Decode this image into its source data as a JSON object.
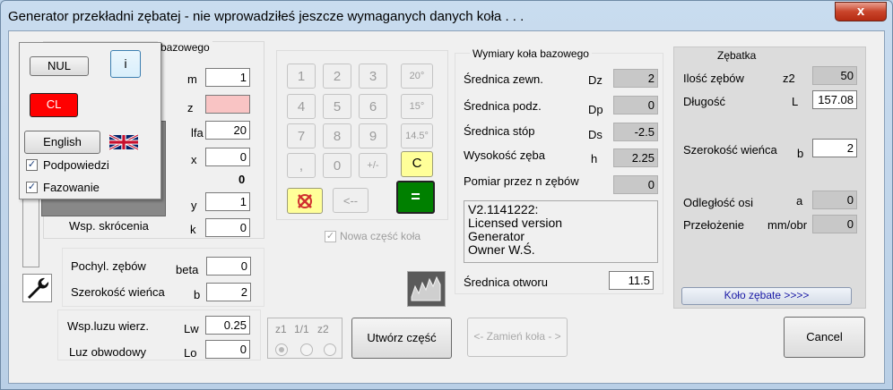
{
  "window": {
    "title": "Generator przekładni zębatej  -  nie wprowadziłeś jeszcze wymaganych danych koła . . .",
    "close_glyph": "x"
  },
  "popup": {
    "nul_label": "NUL",
    "info_label": "i",
    "cl_label": "CL",
    "english_label": "English",
    "podpowiedzi_label": "Podpowiedzi",
    "fazowanie_label": "Fazowanie",
    "podpowiedzi_checked": true,
    "fazowanie_checked": true
  },
  "base_group": {
    "title_tail": "bazowego",
    "rows": [
      {
        "sym": "m",
        "value": "1"
      },
      {
        "sym": "z",
        "value": ""
      },
      {
        "label_tail": "lfa",
        "value": "20"
      },
      {
        "sym": "x",
        "value": "0"
      },
      {
        "value_bold": "0"
      },
      {
        "sym": "y",
        "value": "1"
      },
      {
        "label": "Wsp. skrócenia",
        "sym": "k",
        "value": "0"
      }
    ]
  },
  "helix_group": {
    "pochyl_label": "Pochyl. zębów",
    "pochyl_sym": "beta",
    "pochyl_value": "0",
    "szer_label": "Szerokość wieńca",
    "szer_sym": "b",
    "szer_value": "2"
  },
  "luz_group": {
    "wsp_label": "Wsp.luzu wierz.",
    "wsp_sym": "Lw",
    "wsp_value": "0.25",
    "luz_label": "Luz obwodowy",
    "luz_sym": "Lo",
    "luz_value": "0"
  },
  "keypad": {
    "keys": [
      "1",
      "2",
      "3",
      "20°",
      "4",
      "5",
      "6",
      "15°",
      "7",
      "8",
      "9",
      "14.5°",
      ",",
      "0",
      "+/-",
      "C"
    ],
    "backspace_label": "<--",
    "equals_label": "=",
    "nowa_label": "Nowa część koła",
    "nowa_checked": true
  },
  "dimensions": {
    "title": "Wymiary koła bazowego",
    "rows": [
      {
        "label": "Średnica zewn.",
        "sym": "Dz",
        "value": "2"
      },
      {
        "label": "Średnica podz.",
        "sym": "Dp",
        "value": "0"
      },
      {
        "label": "Średnica stóp",
        "sym": "Ds",
        "value": "-2.5"
      },
      {
        "label": "Wysokość zęba",
        "sym": "h",
        "value": "2.25"
      },
      {
        "label": "Pomiar przez n zębów",
        "sym": "",
        "value": "0"
      }
    ],
    "info_lines": [
      "V2.1141222:",
      "Licensed version",
      "Generator",
      "Owner W.Ś."
    ],
    "otwor_label": "Średnica otworu",
    "otwor_value": "11.5"
  },
  "rack": {
    "title": "Zębatka",
    "ilosc_label": "Ilość zębów",
    "ilosc_sym": "z2",
    "ilosc_value": "50",
    "dlugosc_label": "Długość",
    "dlugosc_sym": "L",
    "dlugosc_value": "157.08",
    "szer_label": "Szerokość wieńca",
    "szer_sym": "b",
    "szer_value": "2",
    "odl_label": "Odległość osi",
    "odl_sym": "a",
    "odl_value": "0",
    "przel_label": "Przełożenie",
    "przel_sym": "mm/obr",
    "przel_value": "0",
    "kolo_button": "Koło zębate >>>>"
  },
  "ratio_group": {
    "labels": [
      "z1",
      "1/1",
      "z2"
    ]
  },
  "actions": {
    "utworz_label": "Utwórz część",
    "zamien_label": "<- Zamień koła - >",
    "cancel_label": "Cancel"
  },
  "colors": {
    "cl_red": "#ff0000",
    "c_yellow": "#ffff99",
    "equals_green": "#008000",
    "rack_panel": "#dcdcdc",
    "kolo_link": "#1a1aa6"
  }
}
